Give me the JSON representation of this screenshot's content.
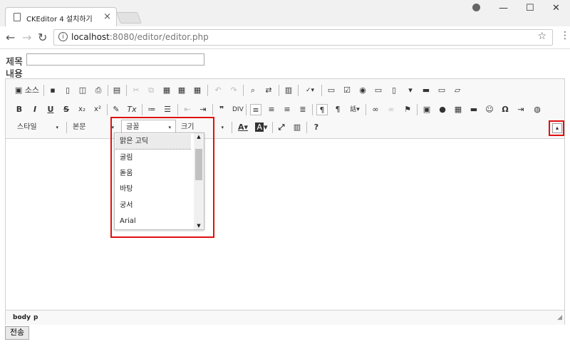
{
  "browser": {
    "tab_title": "CKEditor 4 설치하기",
    "tab_close": "×",
    "url_host": "localhost",
    "url_rest": ":8080/editor/editor.php",
    "back": "←",
    "forward": "→",
    "reload": "↻",
    "info": "i",
    "star": "☆",
    "menu": "⋮",
    "minimize": "—",
    "maximize": "☐",
    "close": "✕"
  },
  "form": {
    "title_label": "제목",
    "content_label": "내용",
    "title_value": "",
    "submit_label": "전송"
  },
  "toolbar": {
    "source_label": "소스",
    "styles_label": "스타일",
    "format_label": "본문",
    "font_label": "글꼴",
    "size_label": "크기",
    "bold": "B",
    "italic": "I",
    "underline": "U",
    "strike": "S",
    "subscript": "x₂",
    "superscript": "x²",
    "remove_format": "Tx",
    "blockquote": "❞",
    "text_color": "A",
    "bg_color": "A",
    "help": "?",
    "omega": "Ω",
    "dropdown_arrow": "▾",
    "collapse": "▴"
  },
  "font_dropdown": {
    "options": [
      "맑은 고딕",
      "굴림",
      "돋움",
      "바탕",
      "궁서",
      "Arial"
    ],
    "selected_index": 0,
    "scroll_up": "▲",
    "scroll_down": "▼"
  },
  "statusbar": {
    "path": [
      "body",
      "p"
    ],
    "resize": "◢"
  },
  "colors": {
    "highlight": "#e01010",
    "toolbar_bg": "#f8f8f8",
    "border": "#d1d1d1"
  }
}
